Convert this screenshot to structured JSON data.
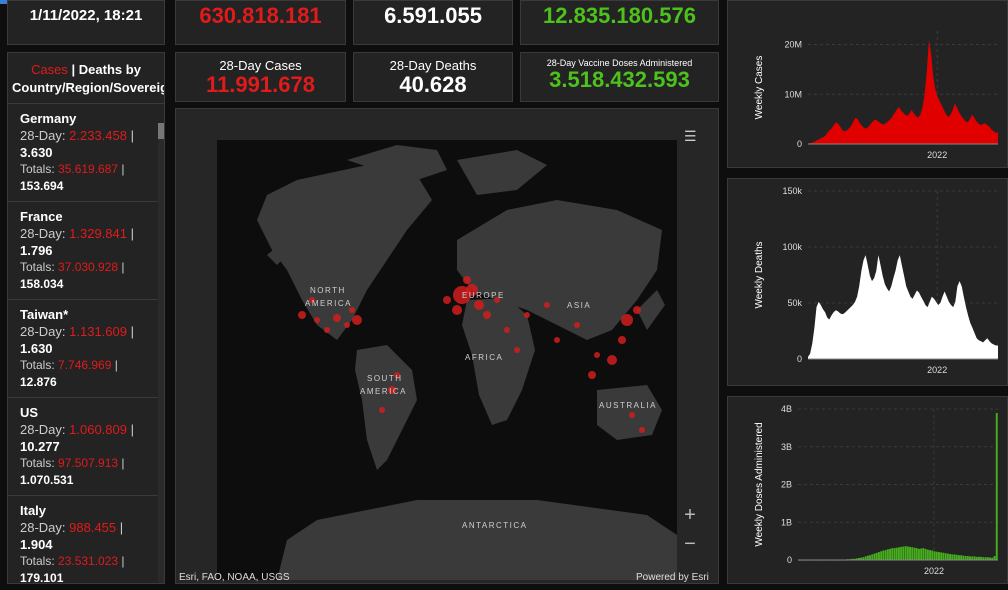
{
  "header": {
    "datetime": "1/11/2022, 18:21",
    "total_cases": "630.818.181",
    "total_deaths": "6.591.055",
    "total_vaccine": "12.835.180.576"
  },
  "stats": [
    {
      "label": "28-Day Cases",
      "value": "11.991.678"
    },
    {
      "label": "28-Day Deaths",
      "value": "40.628"
    },
    {
      "label": "28-Day Vaccine Doses Administered",
      "value": "3.518.432.593"
    }
  ],
  "list": {
    "tab_active": "Cases",
    "tab_separator": " | ",
    "tab_other": "Deaths by Country/Region/Sovereignty",
    "items": [
      {
        "name": "Germany",
        "prefix28": "28-Day: ",
        "cases28": "2.233.458",
        "deaths28": "3.630",
        "prefixTot": "Totals: ",
        "casesTot": "35.619.687",
        "deathsTot": "153.694"
      },
      {
        "name": "France",
        "prefix28": "28-Day: ",
        "cases28": "1.329.841",
        "deaths28": "1.796",
        "prefixTot": "Totals: ",
        "casesTot": "37.030.928",
        "deathsTot": "158.034"
      },
      {
        "name": "Taiwan*",
        "prefix28": "28-Day: ",
        "cases28": "1.131.609",
        "deaths28": "1.630",
        "prefixTot": "Totals: ",
        "casesTot": "7.746.969",
        "deathsTot": "12.876"
      },
      {
        "name": "US",
        "prefix28": "28-Day: ",
        "cases28": "1.060.809",
        "deaths28": "10.277",
        "prefixTot": "Totals: ",
        "casesTot": "97.507.913",
        "deathsTot": "1.070.531"
      },
      {
        "name": "Italy",
        "prefix28": "28-Day: ",
        "cases28": "988.455",
        "deaths28": "1.904",
        "prefixTot": "Totals: ",
        "casesTot": "23.531.023",
        "deathsTot": "179.101"
      }
    ]
  },
  "map": {
    "labels": [
      "NORTH",
      "AMERICA",
      "EUROPE",
      "ASIA",
      "AFRICA",
      "SOUTH",
      "AMERICA",
      "AUSTRALIA",
      "ANTARCTICA"
    ],
    "zoom_in": "+",
    "zoom_out": "−",
    "attribution": "Esri, FAO, NOAA, USGS",
    "powered": "Powered by Esri",
    "list_icon": "list-icon"
  },
  "chart_data": [
    {
      "type": "area",
      "ylabel": "Weekly Cases",
      "yticks": [
        "0",
        "10M",
        "20M"
      ],
      "ylim": [
        0,
        24000000
      ],
      "xtick": "2022",
      "color": "#e00000",
      "values": [
        0.1,
        0.2,
        0.3,
        0.5,
        0.8,
        1.0,
        1.3,
        1.5,
        1.8,
        2.5,
        3.0,
        3.5,
        4.2,
        4.8,
        4.5,
        3.8,
        3.0,
        2.8,
        3.0,
        3.5,
        4.0,
        5.0,
        5.8,
        5.5,
        4.6,
        4.0,
        3.6,
        3.4,
        3.8,
        4.4,
        5.0,
        5.4,
        5.2,
        4.8,
        4.5,
        4.3,
        4.6,
        5.0,
        5.4,
        6.0,
        6.8,
        7.5,
        8.2,
        7.5,
        7.0,
        6.5,
        6.2,
        6.8,
        7.5,
        6.8,
        6.2,
        5.8,
        6.5,
        8.0,
        11.0,
        16.0,
        23.0,
        20.0,
        15.0,
        12.0,
        10.5,
        9.5,
        8.5,
        7.5,
        6.5,
        6.0,
        6.5,
        7.5,
        9.0,
        8.0,
        7.0,
        6.2,
        5.6,
        5.0,
        4.8,
        5.5,
        6.5,
        5.8,
        5.0,
        4.5,
        4.2,
        4.4,
        4.6,
        4.2,
        3.8,
        3.2,
        2.8,
        2.5,
        2.6
      ]
    },
    {
      "type": "area",
      "ylabel": "Weekly Deaths",
      "yticks": [
        "0",
        "50k",
        "100k",
        "150k"
      ],
      "ylim": [
        0,
        150000
      ],
      "xtick": "2022",
      "color": "#ffffff",
      "values": [
        2,
        5,
        15,
        30,
        50,
        55,
        52,
        48,
        45,
        40,
        38,
        42,
        45,
        47,
        46,
        44,
        43,
        44,
        46,
        48,
        50,
        52,
        55,
        60,
        70,
        85,
        95,
        100,
        90,
        80,
        75,
        78,
        85,
        100,
        90,
        80,
        72,
        68,
        65,
        70,
        78,
        85,
        95,
        100,
        90,
        80,
        70,
        65,
        60,
        58,
        62,
        66,
        64,
        60,
        56,
        52,
        50,
        55,
        60,
        58,
        55,
        52,
        54,
        60,
        65,
        60,
        55,
        52,
        50,
        55,
        70,
        75,
        70,
        60,
        50,
        42,
        35,
        30,
        25,
        20,
        18,
        17,
        16,
        18,
        20,
        17,
        15,
        14,
        13,
        13
      ]
    },
    {
      "type": "bar",
      "ylabel": "Weekly Doses Administered",
      "yticks": [
        "0",
        "1B",
        "2B",
        "3B",
        "4B"
      ],
      "ylim": [
        0,
        4000000000
      ],
      "xtick": "2022",
      "color": "#46b01c",
      "values": [
        0.01,
        0.01,
        0.01,
        0.01,
        0.01,
        0.01,
        0.01,
        0.01,
        0.01,
        0.01,
        0.01,
        0.01,
        0.01,
        0.01,
        0.01,
        0.01,
        0.01,
        0.01,
        0.01,
        0.01,
        0.01,
        0.01,
        0.02,
        0.02,
        0.03,
        0.03,
        0.04,
        0.05,
        0.06,
        0.07,
        0.09,
        0.11,
        0.12,
        0.14,
        0.16,
        0.18,
        0.2,
        0.22,
        0.24,
        0.25,
        0.27,
        0.28,
        0.3,
        0.3,
        0.31,
        0.32,
        0.33,
        0.34,
        0.35,
        0.34,
        0.33,
        0.32,
        0.31,
        0.3,
        0.28,
        0.29,
        0.3,
        0.28,
        0.26,
        0.25,
        0.24,
        0.22,
        0.21,
        0.2,
        0.19,
        0.18,
        0.17,
        0.16,
        0.15,
        0.14,
        0.14,
        0.13,
        0.12,
        0.12,
        0.11,
        0.1,
        0.1,
        0.09,
        0.09,
        0.09,
        0.08,
        0.08,
        0.08,
        0.07,
        0.07,
        0.07,
        0.06,
        0.06,
        0.1,
        3.7
      ]
    }
  ]
}
